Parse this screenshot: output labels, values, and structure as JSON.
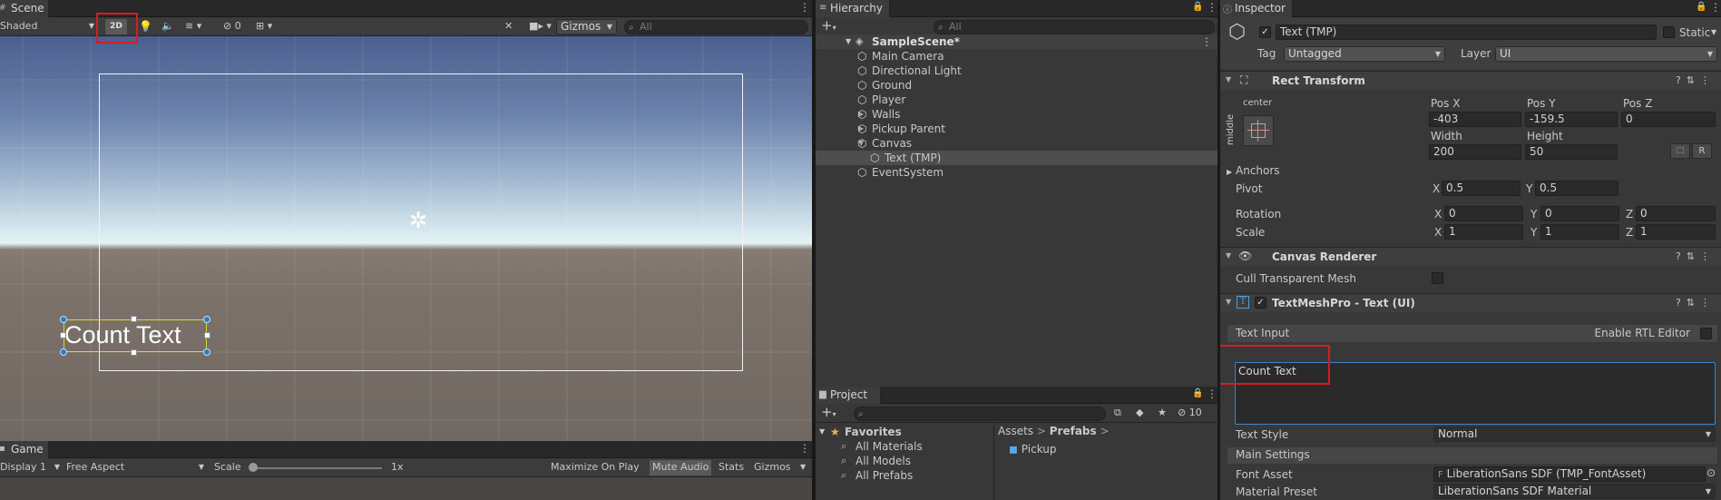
{
  "scene": {
    "tab": "Scene",
    "shading": "Shaded",
    "mode_2d": "2D",
    "hidden_count": "0",
    "gizmos": "Gizmos",
    "search_placeholder": "All",
    "selected_text": "Count Text"
  },
  "game": {
    "tab": "Game",
    "display": "Display 1",
    "aspect": "Free Aspect",
    "scale_label": "Scale",
    "scale_value": "1x",
    "maximize": "Maximize On Play",
    "mute": "Mute Audio",
    "stats": "Stats",
    "gizmos": "Gizmos"
  },
  "hierarchy": {
    "tab": "Hierarchy",
    "search_placeholder": "All",
    "scene_name": "SampleScene*",
    "items": [
      "Main Camera",
      "Directional Light",
      "Ground",
      "Player",
      "Walls",
      "Pickup Parent",
      "Canvas",
      "Text (TMP)",
      "EventSystem"
    ]
  },
  "project": {
    "tab": "Project",
    "hidden_count": "10",
    "favorites": "Favorites",
    "favorite_items": [
      "All Materials",
      "All Models",
      "All Prefabs"
    ],
    "breadcrumb": [
      "Assets",
      "Prefabs"
    ],
    "assets": [
      "Pickup"
    ]
  },
  "inspector": {
    "tab": "Inspector",
    "object_name": "Text (TMP)",
    "static_label": "Static",
    "tag_label": "Tag",
    "tag_value": "Untagged",
    "layer_label": "Layer",
    "layer_value": "UI",
    "rect_transform": {
      "title": "Rect Transform",
      "anchor_h": "center",
      "anchor_v": "middle",
      "pos_x_label": "Pos X",
      "pos_x": "-403",
      "pos_y_label": "Pos Y",
      "pos_y": "-159.5",
      "pos_z_label": "Pos Z",
      "pos_z": "0",
      "width_label": "Width",
      "width": "200",
      "height_label": "Height",
      "height": "50",
      "r_button": "R",
      "anchors_label": "Anchors",
      "pivot_label": "Pivot",
      "pivot_x": "0.5",
      "pivot_y": "0.5",
      "rotation_label": "Rotation",
      "rot_x": "0",
      "rot_y": "0",
      "rot_z": "0",
      "scale_label": "Scale",
      "scale_x": "1",
      "scale_y": "1",
      "scale_z": "1",
      "x": "X",
      "y": "Y",
      "z": "Z"
    },
    "canvas_renderer": {
      "title": "Canvas Renderer",
      "cull_label": "Cull Transparent Mesh"
    },
    "tmp": {
      "title": "TextMeshPro - Text (UI)",
      "text_input_label": "Text Input",
      "rtl_label": "Enable RTL Editor",
      "text_value": "Count Text",
      "text_style_label": "Text Style",
      "text_style_value": "Normal",
      "main_settings": "Main Settings",
      "font_asset_label": "Font Asset",
      "font_asset_value": "LiberationSans SDF (TMP_FontAsset)",
      "material_preset_label": "Material Preset",
      "material_preset_value": "LiberationSans SDF Material"
    }
  }
}
